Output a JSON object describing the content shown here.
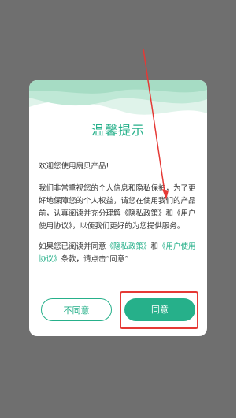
{
  "dialog": {
    "title": "温馨提示",
    "greeting": "欢迎您使用扇贝产品!",
    "paragraph1": "我们非常重视您的个人信息和隐私保护，为了更好地保障您的个人权益，请您在使用我们的产品前，认真阅读并充分理解《隐私政策》和《用户使用协议》，以便我们更好的为您提供服务。",
    "paragraph2_before": "如果您已阅读并同意",
    "privacy_link": "《隐私政策》",
    "paragraph2_and": "和",
    "user_agreement_link": "《用户使用协议》",
    "paragraph2_after": "条款，请点击“同意”",
    "disagree_label": "不同意",
    "agree_label": "同意"
  },
  "colors": {
    "accent": "#26b08a",
    "overlay": "#6f6f6f",
    "annotation": "#e53935"
  }
}
